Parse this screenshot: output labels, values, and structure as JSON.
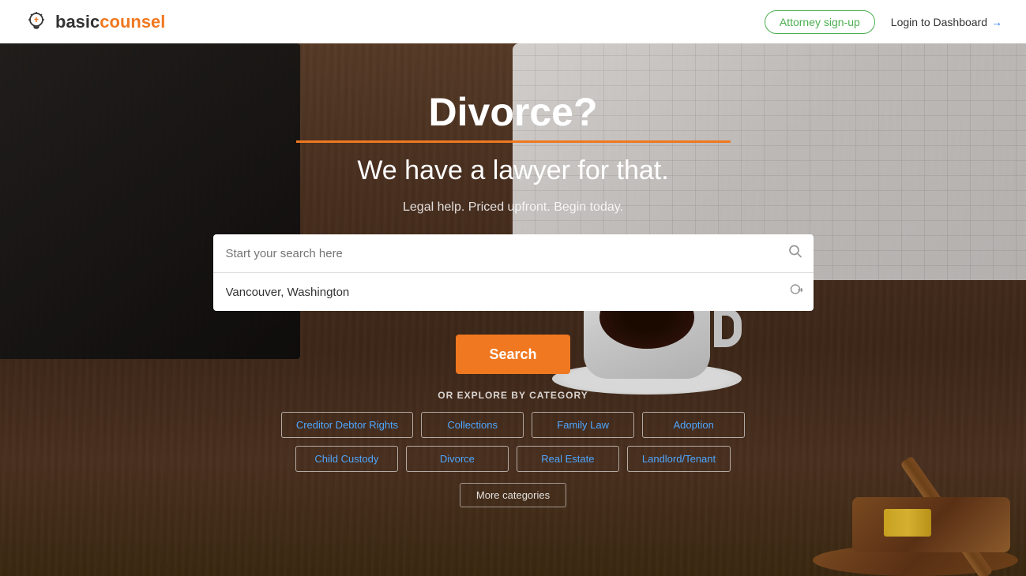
{
  "header": {
    "logo_basic": "basic",
    "logo_counsel": "counsel",
    "attorney_signup_label": "Attorney sign-up",
    "login_label": "Login to Dashboard"
  },
  "hero": {
    "headline": "Divorce?",
    "subheadline": "We have a lawyer for that.",
    "tagline": "Legal help. Priced upfront. Begin today.",
    "search_placeholder": "Start your search here",
    "location_value": "Vancouver, Washington",
    "search_button_label": "Search",
    "explore_label": "OR EXPLORE BY CATEGORY",
    "categories_row1": [
      "Creditor Debtor Rights",
      "Collections",
      "Family Law",
      "Adoption"
    ],
    "categories_row2": [
      "Child Custody",
      "Divorce",
      "Real Estate",
      "Landlord/Tenant"
    ],
    "more_categories_label": "More categories"
  }
}
